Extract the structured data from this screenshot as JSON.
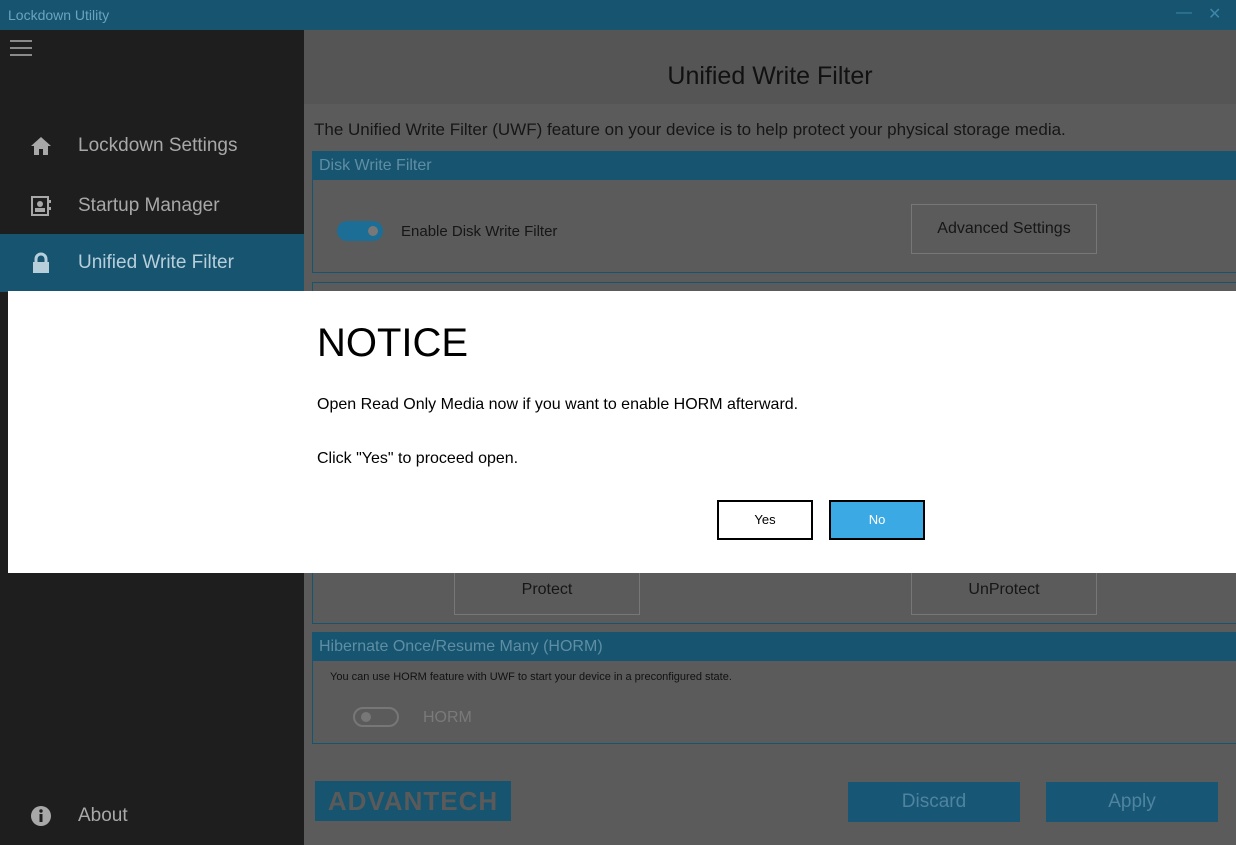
{
  "window": {
    "title": "Lockdown Utility",
    "minimize_glyph": "—",
    "close_glyph": "✕"
  },
  "sidebar": {
    "items": [
      {
        "label": "Lockdown Settings",
        "icon": "home-icon"
      },
      {
        "label": "Startup Manager",
        "icon": "startup-icon"
      },
      {
        "label": "Unified Write Filter",
        "icon": "lock-icon",
        "active": true
      }
    ],
    "about": {
      "label": "About",
      "icon": "info-icon"
    }
  },
  "main": {
    "title": "Unified Write Filter",
    "intro": "The Unified Write Filter (UWF) feature on your device is to help protect your physical storage media.",
    "disk_filter": {
      "heading": "Disk Write Filter",
      "toggle_label": "Enable Disk Write Filter",
      "toggle_on": true,
      "advanced_button": "Advanced Settings"
    },
    "protect_button": "Protect",
    "unprotect_button": "UnProtect",
    "horm": {
      "heading": "Hibernate Once/Resume Many (HORM)",
      "description": "You can use HORM feature with UWF to start your device in a preconfigured state.",
      "toggle_label": "HORM",
      "toggle_on": false
    }
  },
  "footer": {
    "logo_text": "ADVANTECH",
    "discard_label": "Discard",
    "apply_label": "Apply"
  },
  "dialog": {
    "title": "NOTICE",
    "message_line1": "Open Read Only Media now if you want to enable HORM afterward.",
    "message_line2": "Click \"Yes\" to proceed open.",
    "yes_label": "Yes",
    "no_label": "No"
  },
  "colors": {
    "accent": "#17546f",
    "primary_button": "#3aa9e4"
  }
}
